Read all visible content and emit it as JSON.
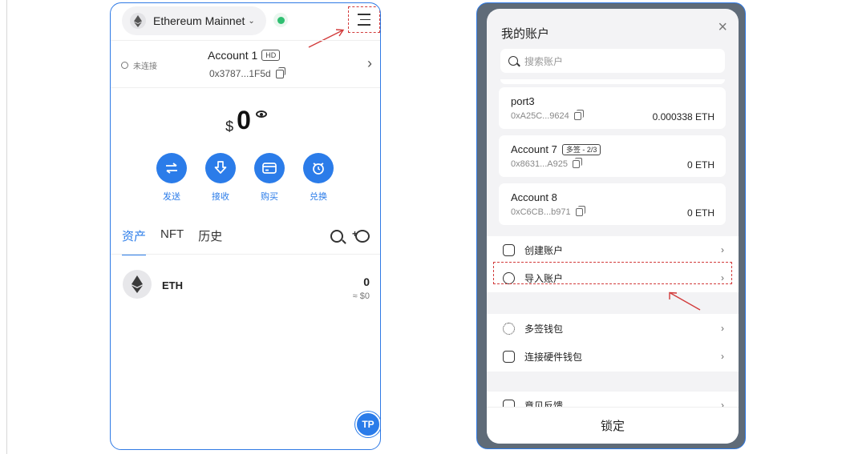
{
  "left": {
    "network": {
      "name": "Ethereum Mainnet",
      "chevron": "⌄",
      "icon": "eth-icon",
      "status_color": "#2fbf71"
    },
    "menu_icon": "hamburger-icon",
    "account": {
      "status": "未连接",
      "name": "Account 1",
      "badge": "HD",
      "address": "0x3787...1F5d",
      "chevron": "›"
    },
    "balance": {
      "currency": "$",
      "value": "0"
    },
    "actions": [
      {
        "label": "发送",
        "icon": "transfer-icon"
      },
      {
        "label": "接收",
        "icon": "download-icon"
      },
      {
        "label": "购买",
        "icon": "card-icon"
      },
      {
        "label": "兑换",
        "icon": "swap-icon"
      }
    ],
    "tabs": [
      {
        "label": "资产",
        "active": true
      },
      {
        "label": "NFT",
        "active": false
      },
      {
        "label": "历史",
        "active": false
      }
    ],
    "tokens": [
      {
        "symbol": "ETH",
        "amount": "0",
        "fiat": "≈ $0"
      }
    ],
    "badge": "TP",
    "accent": "#2b7ce9"
  },
  "right": {
    "title": "我的账户",
    "close": "×",
    "search_placeholder": "搜索账户",
    "accounts": [
      {
        "name": "port3",
        "address": "0xA25C...9624",
        "balance": "0.000338 ETH",
        "badge": ""
      },
      {
        "name": "Account 7",
        "address": "0x8631...A925",
        "balance": "0 ETH",
        "badge": "多签 - 2/3"
      },
      {
        "name": "Account 8",
        "address": "0xC6CB...b971",
        "balance": "0 ETH",
        "badge": ""
      }
    ],
    "menu_group_1": [
      {
        "label": "创建账户",
        "icon": "create-account-icon"
      },
      {
        "label": "导入账户",
        "icon": "import-account-icon"
      }
    ],
    "menu_group_2": [
      {
        "label": "多签钱包",
        "icon": "multisig-wallet-icon"
      },
      {
        "label": "连接硬件钱包",
        "icon": "hardware-wallet-icon"
      }
    ],
    "menu_group_3": [
      {
        "label": "意见反馈",
        "icon": "feedback-icon"
      }
    ],
    "chevron": "›",
    "lock_label": "锁定"
  }
}
